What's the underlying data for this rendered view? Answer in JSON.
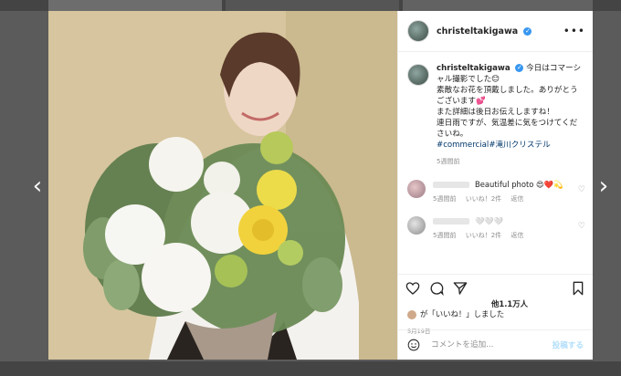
{
  "post": {
    "username": "christeltakigawa",
    "verified_symbol": "✓",
    "caption_lines": [
      "今日はコマーシャル撮影でした😊",
      "素敵なお花を頂戴しました。ありがとうございます💕",
      "また詳細は後日お伝えしますね！",
      "連日雨ですが、気温差に気をつけてくださいね。"
    ],
    "hashtags": "#commercial#滝川クリステル",
    "caption_age": "5週間前"
  },
  "comments": [
    {
      "text": "Beautiful photo 😍❤️💫",
      "age": "5週間前",
      "likes": "いいね！2件",
      "reply": "返信"
    },
    {
      "text": "🤍🤍🤍",
      "age": "5週間前",
      "likes": "いいね！2件",
      "reply": "返信"
    }
  ],
  "engagement": {
    "likes_count": "他1.1万人",
    "liked_by_suffix": "が「いいね！」しました",
    "date": "5月19日"
  },
  "composer": {
    "placeholder": "コメントを追加...",
    "post_label": "投稿する"
  },
  "nav": {
    "prev": "‹",
    "next": "›"
  },
  "icons": {
    "more": "more-icon",
    "heart": "heart-icon",
    "comment": "comment-icon",
    "share": "share-icon",
    "bookmark": "bookmark-icon",
    "emoji": "emoji-icon"
  },
  "colors": {
    "link": "#00376b",
    "verified": "#3897f0",
    "muted": "#8e8e8e",
    "post_button": "#b2dffc"
  }
}
